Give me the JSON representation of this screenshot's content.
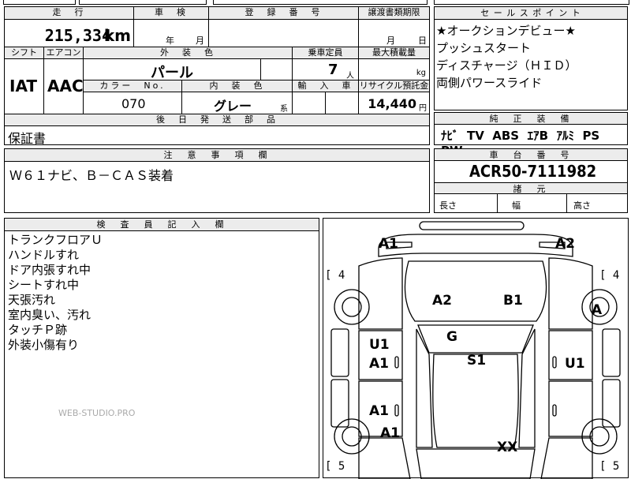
{
  "top_fragment": "---",
  "mileage": {
    "label": "走　行",
    "value": "215,334",
    "unit": "km"
  },
  "inspection": {
    "label": "車　検",
    "year": "年",
    "month": "月"
  },
  "registration": {
    "label": "登　録　番　号"
  },
  "transfer": {
    "label": "譲渡書類期限",
    "month": "月",
    "day": "日"
  },
  "shift": {
    "label": "シフト",
    "value": "IAT"
  },
  "aircon": {
    "label": "エアコン",
    "value": "AAC"
  },
  "exterior_color": {
    "label": "外　装　色",
    "value": "パール"
  },
  "capacity": {
    "label": "乗車定員",
    "value": "7",
    "unit": "人"
  },
  "max_load": {
    "label": "最大積載量",
    "unit": "kg"
  },
  "color_no": {
    "label": "カラー　No.",
    "value": "070"
  },
  "interior_color": {
    "label": "内　装　色",
    "value": "グレー",
    "suffix": "系"
  },
  "import": {
    "label": "輸　入　車"
  },
  "recycle": {
    "label": "リサイクル預託金",
    "value": "14,440",
    "unit": "円"
  },
  "later_parts": {
    "label": "後　日　発　送　部　品",
    "value": "保証書"
  },
  "notes": {
    "label": "注　意　事　項　欄",
    "value": "Ｗ６１ナビ、Ｂ－ＣＡＳ装着"
  },
  "sales_points": {
    "label": "セ ー ル ス ポ イ ン ト",
    "items": [
      "★オークションデビュー★",
      "プッシュスタート",
      "ディスチャージ（ＨＩＤ）",
      "両側パワースライド"
    ]
  },
  "equipment": {
    "label": "純　正　装　備",
    "items": [
      "ﾅﾋﾞ",
      "TV",
      "ABS",
      "ｴｱB",
      "ｱﾙﾐ",
      "PS",
      "PW"
    ]
  },
  "chassis": {
    "label": "車　台　番　号",
    "value": "ACR50-7111982"
  },
  "dimensions": {
    "label": "諸　元",
    "length": "長さ",
    "width": "幅",
    "height": "高さ"
  },
  "inspector": {
    "label": "検　査　員　記　入　欄",
    "items": [
      "トランクフロアＵ",
      "ハンドルすれ",
      "ドア内張すれ中",
      "シートすれ中",
      "天張汚れ",
      "室内臭い、汚れ",
      "タッチＰ跡",
      "外装小傷有り"
    ]
  },
  "watermark": "WEB-STUDIO.PRO",
  "diagram": {
    "tire_front_left": "[ 4",
    "tire_front_right": "[ 4",
    "tire_rear_left": "[ 5",
    "tire_rear_right": "[ 5",
    "labels": {
      "front_left_corner": "A1",
      "front_right_corner": "A2",
      "hood_left": "A2",
      "hood_right": "B1",
      "right_front_wheel": "A",
      "windshield": "G",
      "left_front_door_u": "U1",
      "left_front_door_a": "A1",
      "roof": "S1",
      "right_door": "U1",
      "left_rear_door": "A1",
      "left_rear_quarter": "A1",
      "rear": "XX"
    }
  }
}
